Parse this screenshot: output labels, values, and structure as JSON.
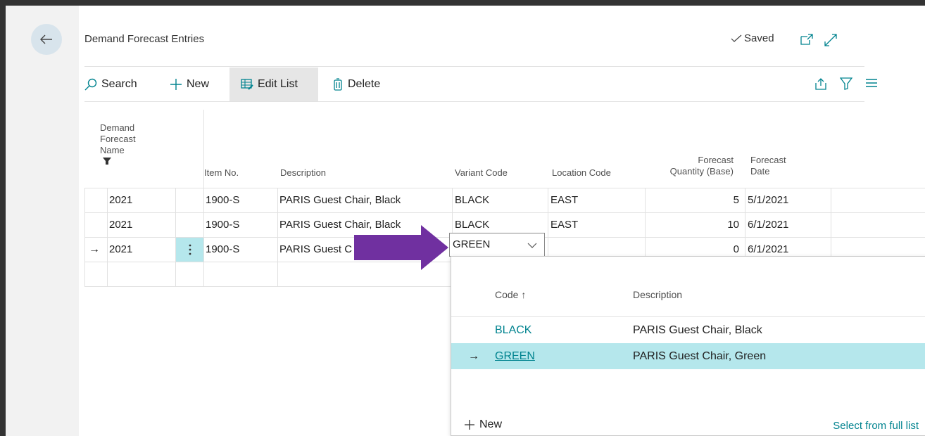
{
  "page": {
    "title": "Demand Forecast Entries",
    "status": "Saved"
  },
  "toolbar": {
    "search": "Search",
    "new": "New",
    "edit_list": "Edit List",
    "delete": "Delete"
  },
  "columns": {
    "name_line1": "Demand",
    "name_line2": "Forecast",
    "name_line3": "Name",
    "item_no": "Item No.",
    "description": "Description",
    "variant_code": "Variant Code",
    "location_code": "Location Code",
    "qty_line1": "Forecast",
    "qty_line2": "Quantity (Base)",
    "date_line1": "Forecast",
    "date_line2": "Date"
  },
  "rows": [
    {
      "name": "2021",
      "item_no": "1900-S",
      "description": "PARIS Guest Chair, Black",
      "variant": "BLACK",
      "location": "EAST",
      "qty": "5",
      "date": "5/1/2021"
    },
    {
      "name": "2021",
      "item_no": "1900-S",
      "description": "PARIS Guest Chair, Black",
      "variant": "BLACK",
      "location": "EAST",
      "qty": "10",
      "date": "6/1/2021"
    },
    {
      "name": "2021",
      "item_no": "1900-S",
      "description": "PARIS Guest C",
      "variant": "GREEN",
      "location": "",
      "qty": "0",
      "date": "6/1/2021"
    }
  ],
  "lookup": {
    "col_code": "Code ↑",
    "col_description": "Description",
    "items": [
      {
        "code": "BLACK",
        "description": "PARIS Guest Chair, Black"
      },
      {
        "code": "GREEN",
        "description": "PARIS Guest Chair, Green"
      }
    ],
    "new": "New",
    "select_full": "Select from full list"
  },
  "colors": {
    "accent": "#00838f",
    "selected_row": "#b5e7ec",
    "callout_arrow": "#7030a0"
  }
}
